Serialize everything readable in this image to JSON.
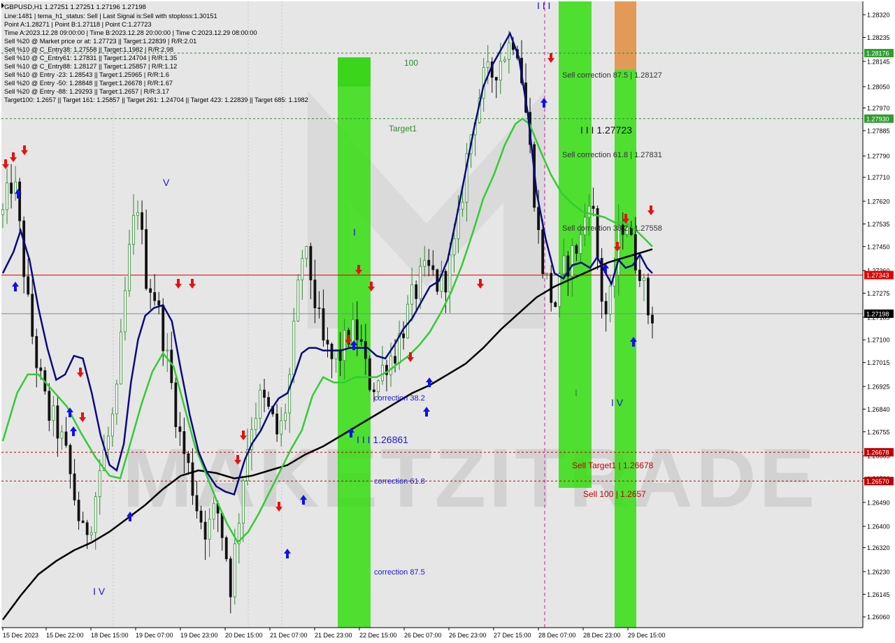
{
  "chart_data": {
    "type": "candlestick",
    "symbol": "GBPUSD,H1",
    "ohlc_header": "1.27251 1.27251 1.27196 1.27198",
    "info_lines": [
      "Line:1481 | tema_h1_status: Sell | Last Signal is:Sell with stoploss:1.30151",
      "Point A:1.28271 | Point B:1.27118 | Point C:1.27723",
      "Time A:2023.12.28 09:00:00 | Time B:2023.12.28 20:00:00 | Time C:2023.12.29 08:00:00",
      "Sell %20 @ Market price or at: 1.27723 || Target:1.22839 | R/R:2.01",
      "Sell %10 @ C_Entry38: 1.27558 || Target:1.1982 | R/R:2.98",
      "Sell %10 @ C_Entry61: 1.27831 || Target:1.24704 | R/R:1.35",
      "Sell %10 @ C_Entry88: 1.28127 || Target:1.25857 | R/R:1.12",
      "Sell %10 @ Entry -23: 1.28543 || Target:1.25965 | R/R:1.6",
      "Sell %20 @ Entry -50: 1.28848 || Target:1.26678 | R/R:1.67",
      "Sell %20 @ Entry -88: 1.29293 || Target:1.2657 | R/R:3.17",
      "Target100: 1.2657 || Target 161: 1.25857 || Target 261: 1.24704 || Target 423: 1.22839 || Target 685: 1.1982"
    ],
    "y_ticks": [
      "1.28320",
      "1.28235",
      "1.28145",
      "1.28050",
      "1.27970",
      "1.27885",
      "1.27790",
      "1.27710",
      "1.27620",
      "1.27535",
      "1.27450",
      "1.27360",
      "1.27275",
      "1.27185",
      "1.27100",
      "1.27015",
      "1.26925",
      "1.26840",
      "1.26755",
      "1.26665",
      "1.26580",
      "1.26490",
      "1.26400",
      "1.26320",
      "1.26230",
      "1.26145",
      "1.26060"
    ],
    "x_ticks": [
      "15 Dec 2023",
      "15 Dec 22:00",
      "18 Dec 15:00",
      "19 Dec 07:00",
      "19 Dec 23:00",
      "20 Dec 15:00",
      "21 Dec 07:00",
      "21 Dec 23:00",
      "22 Dec 15:00",
      "26 Dec 07:00",
      "26 Dec 23:00",
      "27 Dec 15:00",
      "28 Dec 07:00",
      "28 Dec 23:00",
      "29 Dec 15:00"
    ],
    "ylim": [
      1.2602,
      1.2837
    ],
    "n_bars": 155,
    "close_path": [
      [
        0,
        1.2757
      ],
      [
        6,
        1.2772
      ],
      [
        10,
        1.2748
      ],
      [
        15,
        1.2718
      ],
      [
        20,
        1.2698
      ],
      [
        25,
        1.2683
      ],
      [
        30,
        1.2678
      ],
      [
        35,
        1.2668
      ],
      [
        40,
        1.2652
      ],
      [
        45,
        1.2636
      ],
      [
        50,
        1.2644
      ],
      [
        55,
        1.2663
      ],
      [
        60,
        1.2675
      ],
      [
        64,
        1.2688
      ],
      [
        68,
        1.2722
      ],
      [
        72,
        1.2748
      ],
      [
        76,
        1.2762
      ],
      [
        80,
        1.2735
      ],
      [
        85,
        1.2728
      ],
      [
        90,
        1.2712
      ],
      [
        95,
        1.2692
      ],
      [
        100,
        1.2672
      ],
      [
        105,
        1.266
      ],
      [
        110,
        1.2645
      ],
      [
        115,
        1.2638
      ],
      [
        120,
        1.2648
      ],
      [
        125,
        1.2632
      ],
      [
        128,
        1.2618
      ],
      [
        132,
        1.264
      ],
      [
        136,
        1.2665
      ],
      [
        140,
        1.268
      ],
      [
        145,
        1.2688
      ],
      [
        150,
        1.2682
      ],
      [
        155,
        1.2673
      ],
      [
        160,
        1.2688
      ],
      [
        164,
        1.2715
      ],
      [
        168,
        1.2742
      ],
      [
        172,
        1.2738
      ],
      [
        176,
        1.2722
      ],
      [
        180,
        1.2708
      ],
      [
        185,
        1.2702
      ],
      [
        190,
        1.2705
      ],
      [
        195,
        1.2713
      ],
      [
        200,
        1.2712
      ],
      [
        205,
        1.2695
      ],
      [
        210,
        1.2693
      ],
      [
        215,
        1.2702
      ],
      [
        220,
        1.2705
      ],
      [
        225,
        1.2715
      ],
      [
        230,
        1.2725
      ],
      [
        235,
        1.2733
      ],
      [
        240,
        1.2736
      ],
      [
        245,
        1.273
      ],
      [
        250,
        1.2735
      ],
      [
        255,
        1.2748
      ],
      [
        260,
        1.2775
      ],
      [
        265,
        1.2795
      ],
      [
        270,
        1.2807
      ],
      [
        275,
        1.281
      ],
      [
        280,
        1.2816
      ],
      [
        285,
        1.2821
      ],
      [
        288,
        1.2826
      ],
      [
        291,
        1.2812
      ],
      [
        294,
        1.2795
      ],
      [
        298,
        1.277
      ],
      [
        302,
        1.2742
      ],
      [
        306,
        1.2731
      ],
      [
        310,
        1.2722
      ],
      [
        315,
        1.2736
      ],
      [
        320,
        1.2742
      ],
      [
        325,
        1.2748
      ],
      [
        330,
        1.2768
      ],
      [
        334,
        1.2742
      ],
      [
        338,
        1.2718
      ],
      [
        342,
        1.2726
      ],
      [
        346,
        1.2748
      ],
      [
        350,
        1.2758
      ],
      [
        354,
        1.2742
      ],
      [
        358,
        1.2738
      ],
      [
        362,
        1.2721
      ],
      [
        365,
        1.27198
      ]
    ],
    "bar_count_note": "",
    "sma_blue": [
      [
        0,
        1.2735
      ],
      [
        6,
        1.2743
      ],
      [
        10,
        1.2751
      ],
      [
        15,
        1.274
      ],
      [
        20,
        1.2722
      ],
      [
        25,
        1.2707
      ],
      [
        30,
        1.2695
      ],
      [
        35,
        1.2697
      ],
      [
        40,
        1.2704
      ],
      [
        45,
        1.2703
      ],
      [
        50,
        1.269
      ],
      [
        55,
        1.2674
      ],
      [
        60,
        1.2663
      ],
      [
        64,
        1.2661
      ],
      [
        68,
        1.2671
      ],
      [
        72,
        1.2694
      ],
      [
        76,
        1.271
      ],
      [
        80,
        1.2719
      ],
      [
        85,
        1.2722
      ],
      [
        90,
        1.2723
      ],
      [
        95,
        1.2717
      ],
      [
        100,
        1.2699
      ],
      [
        105,
        1.2682
      ],
      [
        110,
        1.2668
      ],
      [
        115,
        1.266
      ],
      [
        120,
        1.2655
      ],
      [
        125,
        1.2653
      ],
      [
        130,
        1.2652
      ],
      [
        136,
        1.2665
      ],
      [
        140,
        1.2671
      ],
      [
        145,
        1.2676
      ],
      [
        150,
        1.2683
      ],
      [
        155,
        1.2688
      ],
      [
        160,
        1.269
      ],
      [
        164,
        1.2697
      ],
      [
        168,
        1.2705
      ],
      [
        172,
        1.2707
      ],
      [
        176,
        1.2707
      ],
      [
        180,
        1.2706
      ],
      [
        185,
        1.2706
      ],
      [
        190,
        1.2706
      ],
      [
        195,
        1.2707
      ],
      [
        200,
        1.2707
      ],
      [
        205,
        1.2707
      ],
      [
        210,
        1.2704
      ],
      [
        215,
        1.2703
      ],
      [
        220,
        1.2708
      ],
      [
        225,
        1.2714
      ],
      [
        230,
        1.2718
      ],
      [
        235,
        1.2724
      ],
      [
        240,
        1.273
      ],
      [
        245,
        1.2732
      ],
      [
        250,
        1.274
      ],
      [
        255,
        1.2756
      ],
      [
        260,
        1.2773
      ],
      [
        265,
        1.279
      ],
      [
        270,
        1.2805
      ],
      [
        275,
        1.2813
      ],
      [
        280,
        1.2819
      ],
      [
        285,
        1.2825
      ],
      [
        290,
        1.2816
      ],
      [
        295,
        1.2795
      ],
      [
        300,
        1.2765
      ],
      [
        305,
        1.2748
      ],
      [
        310,
        1.2735
      ],
      [
        315,
        1.2733
      ],
      [
        320,
        1.2738
      ],
      [
        325,
        1.2739
      ],
      [
        330,
        1.2737
      ],
      [
        334,
        1.2741
      ],
      [
        338,
        1.2736
      ],
      [
        342,
        1.2731
      ],
      [
        346,
        1.274
      ],
      [
        350,
        1.2737
      ],
      [
        354,
        1.2738
      ],
      [
        358,
        1.2742
      ],
      [
        362,
        1.2737
      ],
      [
        365,
        1.2735
      ]
    ],
    "sma_green": [
      [
        0,
        1.2672
      ],
      [
        8,
        1.269
      ],
      [
        14,
        1.2697
      ],
      [
        20,
        1.2697
      ],
      [
        28,
        1.2691
      ],
      [
        36,
        1.2685
      ],
      [
        44,
        1.2675
      ],
      [
        52,
        1.2666
      ],
      [
        60,
        1.2659
      ],
      [
        66,
        1.2658
      ],
      [
        72,
        1.2672
      ],
      [
        78,
        1.2686
      ],
      [
        84,
        1.2698
      ],
      [
        90,
        1.2705
      ],
      [
        96,
        1.27
      ],
      [
        102,
        1.2685
      ],
      [
        108,
        1.267
      ],
      [
        114,
        1.266
      ],
      [
        120,
        1.265
      ],
      [
        126,
        1.2641
      ],
      [
        132,
        1.2634
      ],
      [
        138,
        1.2638
      ],
      [
        144,
        1.2645
      ],
      [
        150,
        1.2653
      ],
      [
        156,
        1.2661
      ],
      [
        162,
        1.2669
      ],
      [
        168,
        1.2676
      ],
      [
        174,
        1.2689
      ],
      [
        180,
        1.2696
      ],
      [
        186,
        1.2694
      ],
      [
        192,
        1.2694
      ],
      [
        198,
        1.2696
      ],
      [
        204,
        1.2696
      ],
      [
        210,
        1.2696
      ],
      [
        216,
        1.2698
      ],
      [
        222,
        1.2701
      ],
      [
        228,
        1.2704
      ],
      [
        234,
        1.2708
      ],
      [
        240,
        1.2713
      ],
      [
        246,
        1.272
      ],
      [
        252,
        1.2728
      ],
      [
        258,
        1.2738
      ],
      [
        264,
        1.275
      ],
      [
        270,
        1.2763
      ],
      [
        276,
        1.2772
      ],
      [
        282,
        1.2783
      ],
      [
        288,
        1.2791
      ],
      [
        292,
        1.2793
      ],
      [
        296,
        1.2791
      ],
      [
        302,
        1.2781
      ],
      [
        308,
        1.2772
      ],
      [
        314,
        1.2765
      ],
      [
        320,
        1.2761
      ],
      [
        326,
        1.2758
      ],
      [
        332,
        1.2757
      ],
      [
        338,
        1.2756
      ],
      [
        344,
        1.2754
      ],
      [
        350,
        1.2754
      ],
      [
        356,
        1.2751
      ],
      [
        362,
        1.2747
      ],
      [
        365,
        1.2745
      ]
    ],
    "sma_black": [
      [
        0,
        1.2605
      ],
      [
        10,
        1.2614
      ],
      [
        20,
        1.2622
      ],
      [
        30,
        1.2627
      ],
      [
        40,
        1.2631
      ],
      [
        50,
        1.2634
      ],
      [
        60,
        1.2638
      ],
      [
        70,
        1.2643
      ],
      [
        80,
        1.2648
      ],
      [
        90,
        1.2654
      ],
      [
        100,
        1.2659
      ],
      [
        110,
        1.2661
      ],
      [
        120,
        1.266
      ],
      [
        130,
        1.2658
      ],
      [
        140,
        1.2659
      ],
      [
        150,
        1.2661
      ],
      [
        160,
        1.2663
      ],
      [
        170,
        1.2667
      ],
      [
        180,
        1.267
      ],
      [
        190,
        1.2674
      ],
      [
        200,
        1.2678
      ],
      [
        210,
        1.2682
      ],
      [
        220,
        1.2686
      ],
      [
        230,
        1.269
      ],
      [
        240,
        1.2693
      ],
      [
        250,
        1.2697
      ],
      [
        260,
        1.2701
      ],
      [
        270,
        1.2707
      ],
      [
        280,
        1.2714
      ],
      [
        290,
        1.272
      ],
      [
        300,
        1.2726
      ],
      [
        310,
        1.273
      ],
      [
        320,
        1.2733
      ],
      [
        330,
        1.2736
      ],
      [
        340,
        1.2739
      ],
      [
        350,
        1.2741
      ],
      [
        360,
        1.2743
      ],
      [
        365,
        1.2744
      ]
    ],
    "horizontal_lines": [
      {
        "value": 1.28176,
        "color": "#2e8b2e",
        "style": "dashed",
        "label": "1.28176"
      },
      {
        "value": 1.2793,
        "color": "#2e8b2e",
        "style": "dashed",
        "label": "1.27930"
      },
      {
        "value": 1.27343,
        "color": "#e00000",
        "style": "solid",
        "label": "1.27343"
      },
      {
        "value": 1.27198,
        "color": "#7f8a96",
        "style": "solid",
        "label": "1.27198"
      },
      {
        "value": 1.26678,
        "color": "#c00000",
        "style": "dashed",
        "label": "1.26678"
      },
      {
        "value": 1.2657,
        "color": "#c00000",
        "style": "dashed",
        "label": "1.26570"
      }
    ],
    "annotations": [
      {
        "text": "100",
        "color": "#2e8b2e"
      },
      {
        "text": "Target1",
        "color": "#2e8b2e"
      },
      {
        "text": "Sell correction 87.5 | 1.28127",
        "color": "#333333"
      },
      {
        "text": "I I I 1.27723",
        "color": "#111111"
      },
      {
        "text": "Sell correction 61.8 | 1.27831",
        "color": "#333333"
      },
      {
        "text": "Sell correction 38.2 | 1.27558",
        "color": "#333333"
      },
      {
        "text": "correction 38.2",
        "color": "#1a1acc"
      },
      {
        "text": "I I I 1.26861",
        "color": "#1a1acc"
      },
      {
        "text": "correction 61.8",
        "color": "#1a1acc"
      },
      {
        "text": "correction 87.5",
        "color": "#1a1acc"
      },
      {
        "text": "Sell Target1 | 1.26678",
        "color": "#c00000"
      },
      {
        "text": "Sell 100 | 1.2657",
        "color": "#c00000"
      },
      {
        "text": "V",
        "color": "#1a1acc"
      },
      {
        "text": "I V",
        "color": "#1a1acc"
      },
      {
        "text": "I",
        "color": "#1a1acc"
      },
      {
        "text": "I I I",
        "color": "#1a1acc"
      },
      {
        "text": "I",
        "color": "#2e8b2e"
      },
      {
        "text": "I V",
        "color": "#1a1acc"
      }
    ],
    "watermark": "MAKETZITRADE",
    "colors": {
      "bull": "#2e8b2e",
      "bear": "#111111",
      "zone": "#33dd11",
      "zone_sell": "#e08c3c"
    }
  }
}
